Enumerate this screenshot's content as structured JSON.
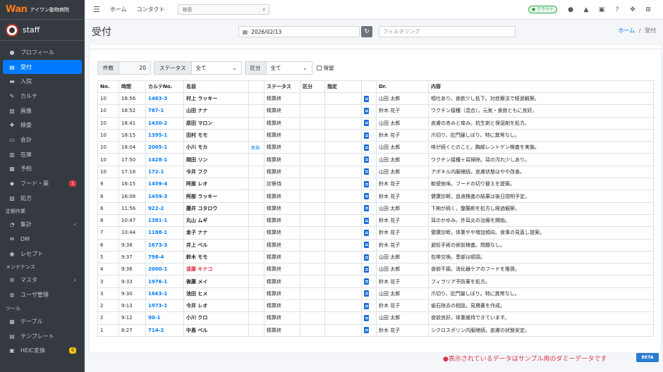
{
  "brand": {
    "logo": "Wan",
    "name": "アイワン動物病院"
  },
  "user": {
    "name": "staff"
  },
  "sidebar": {
    "items": [
      {
        "label": "プロフィール",
        "icon": "user-icon"
      },
      {
        "label": "受付",
        "icon": "reception-icon",
        "active": true
      },
      {
        "label": "入院",
        "icon": "bed-icon"
      },
      {
        "label": "カルテ",
        "icon": "chart-icon"
      },
      {
        "label": "画像",
        "icon": "image-icon"
      },
      {
        "label": "検査",
        "icon": "test-icon"
      },
      {
        "label": "会計",
        "icon": "cash-icon"
      },
      {
        "label": "在庫",
        "icon": "stock-icon"
      },
      {
        "label": "予約",
        "icon": "calendar-icon"
      },
      {
        "label": "フード・薬",
        "icon": "food-icon",
        "badge": "1"
      },
      {
        "label": "処方",
        "icon": "prescription-icon"
      }
    ],
    "section_periodic": "定期作業",
    "periodic": [
      {
        "label": "集計",
        "icon": "pie-icon",
        "arrow": "‹"
      },
      {
        "label": "DM",
        "icon": "mail-icon"
      },
      {
        "label": "レセプト",
        "icon": "receipt-icon"
      }
    ],
    "section_maint": "メンテナンス",
    "maint": [
      {
        "label": "マスタ",
        "icon": "gear-icon",
        "arrow": "‹"
      },
      {
        "label": "ユーザ管理",
        "icon": "users-icon"
      }
    ],
    "section_tools": "ツール",
    "tools": [
      {
        "label": "テーブル",
        "icon": "table-icon"
      },
      {
        "label": "テンプレート",
        "icon": "template-icon"
      },
      {
        "label": "HEIC変換",
        "icon": "convert-icon",
        "badge": "6"
      }
    ]
  },
  "topbar": {
    "home": "ホーム",
    "contact": "コンタクト",
    "search_placeholder": "検索",
    "cloud": "● クラウド"
  },
  "header": {
    "title": "受付",
    "date": "2026/02/13",
    "filter_placeholder": "フィルタリング",
    "crumb_home": "ホーム",
    "crumb_sep": "/",
    "crumb_current": "受付"
  },
  "filters": {
    "count_label": "件数",
    "count_value": "20",
    "status_label": "ステータス",
    "status_value": "全て",
    "kubun_label": "区分",
    "kubun_value": "全て",
    "hold_label": "保留"
  },
  "table": {
    "headers": [
      "No.",
      "時間",
      "カルテNo.",
      "名前",
      "",
      "ステータス",
      "区分",
      "指定",
      "",
      "Dr.",
      "内容"
    ],
    "rows": [
      {
        "no": "10",
        "time": "18:56",
        "kid": "1463-3",
        "name": "村上 ラッキー",
        "tag": "",
        "status": "精算終",
        "dr": "山田 太郎",
        "content": "嘔吐あり、食欲少し低下。対症療法で経過観察。"
      },
      {
        "no": "10",
        "time": "18:52",
        "kid": "787-1",
        "name": "山田 ナナ",
        "tag": "",
        "status": "精算終",
        "dr": "鈴木 花子",
        "content": "ワクチン接種（混合）。元気・食欲ともに良好。"
      },
      {
        "no": "10",
        "time": "18:41",
        "kid": "1430-2",
        "name": "原田 マロン",
        "tag": "",
        "status": "精算終",
        "dr": "山田 太郎",
        "content": "皮膚の赤みと痒み。抗生剤と保湿剤を処方。"
      },
      {
        "no": "10",
        "time": "18:15",
        "kid": "1395-1",
        "name": "田村 モモ",
        "tag": "",
        "status": "精算終",
        "dr": "鈴木 花子",
        "content": "爪切り、肛門腺しぼり。特に異常なし。"
      },
      {
        "no": "10",
        "time": "18:04",
        "kid": "2005-1",
        "name": "小川 モカ",
        "tag": "新規",
        "status": "精算終",
        "dr": "山田 太郎",
        "content": "咳が続くとのこと。胸部レントゲン検査を実施。"
      },
      {
        "no": "10",
        "time": "17:50",
        "kid": "1428-1",
        "name": "岡田 リン",
        "tag": "",
        "status": "精算終",
        "dr": "山田 太郎",
        "content": "ワクチン接種＋耳掃除。耳の汚れ少しあり。"
      },
      {
        "no": "10",
        "time": "17:18",
        "kid": "172-1",
        "name": "今井 フク",
        "tag": "",
        "status": "精算終",
        "dr": "山田 太郎",
        "content": "アポキル内服継続。皮膚状態はやや改善。"
      },
      {
        "no": "9",
        "time": "16:15",
        "kid": "1459-4",
        "name": "阿部 レオ",
        "tag": "",
        "status": "診察待",
        "dr": "鈴木 花子",
        "content": "軟便気味。フードの切り替えを提案。"
      },
      {
        "no": "8",
        "time": "16:08",
        "kid": "1459-3",
        "name": "阿部 ラッキー",
        "tag": "",
        "status": "精算終",
        "dr": "鈴木 花子",
        "content": "健康診断。血液検査の結果は後日説明予定。"
      },
      {
        "no": "8",
        "time": "11:56",
        "kid": "922-2",
        "name": "藤井 コタロウ",
        "tag": "",
        "status": "精算終",
        "dr": "山田 太郎",
        "content": "下痢が続く。整腸剤を処方し経過観察。"
      },
      {
        "no": "8",
        "time": "10:47",
        "kid": "1381-1",
        "name": "丸山 ムギ",
        "tag": "",
        "status": "精算終",
        "dr": "鈴木 花子",
        "content": "耳のかゆみ。外耳炎の治療を開始。"
      },
      {
        "no": "7",
        "time": "10:44",
        "kid": "1188-1",
        "name": "金子 ナナ",
        "tag": "",
        "status": "精算終",
        "dr": "鈴木 花子",
        "content": "健康診断。体重やや増加傾向、食事の見直し提案。"
      },
      {
        "no": "6",
        "time": "9:38",
        "kid": "1673-3",
        "name": "井上 ベル",
        "tag": "",
        "status": "精算終",
        "dr": "鈴木 花子",
        "content": "避妊手術の術前検査。問題なし。"
      },
      {
        "no": "5",
        "time": "9:37",
        "kid": "798-4",
        "name": "鈴木 モモ",
        "tag": "",
        "status": "精算終",
        "dr": "山田 太郎",
        "content": "包帯交換。患部は順調。"
      },
      {
        "no": "4",
        "time": "9:36",
        "kid": "2000-1",
        "name": "遠藤 キナコ",
        "red": true,
        "tag": "",
        "status": "精算終",
        "dr": "山田 太郎",
        "content": "食欲不振。消化器ケアのフードを推奨。"
      },
      {
        "no": "3",
        "time": "9:33",
        "kid": "1976-1",
        "name": "後藤 メイ",
        "tag": "",
        "status": "精算終",
        "dr": "鈴木 花子",
        "content": "フィラリア予防薬を処方。"
      },
      {
        "no": "3",
        "time": "9:30",
        "kid": "1663-1",
        "name": "池田 ヒメ",
        "tag": "",
        "status": "精算終",
        "dr": "山田 太郎",
        "content": "爪切り、肛門腺しぼり。特に異常なし。"
      },
      {
        "no": "2",
        "time": "9:13",
        "kid": "1973-1",
        "name": "今井 レオ",
        "tag": "",
        "status": "精算終",
        "dr": "鈴木 花子",
        "content": "歯石除去の相談。見積書を作成。"
      },
      {
        "no": "2",
        "time": "9:12",
        "kid": "90-1",
        "name": "小川 クロ",
        "tag": "",
        "status": "精算終",
        "dr": "山田 太郎",
        "content": "食欲良好。体重維持できています。"
      },
      {
        "no": "1",
        "time": "8:27",
        "kid": "714-2",
        "name": "中島 ベル",
        "tag": "",
        "status": "精算終",
        "dr": "鈴木 花子",
        "content": "シクロスポリン内服継続。皮膚の状態安定。"
      }
    ]
  },
  "footer": {
    "note": "●表示されているデータはサンプル用のダミーデータです",
    "beta": "BETA"
  }
}
